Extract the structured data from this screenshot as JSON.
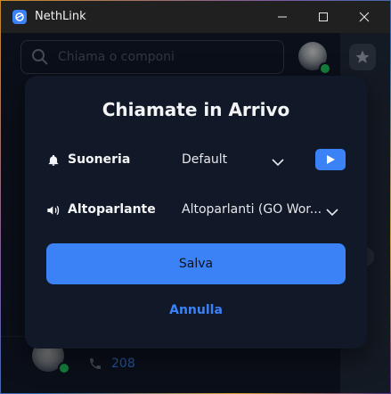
{
  "window": {
    "title": "NethLink"
  },
  "search": {
    "placeholder": "Chiama o componi"
  },
  "list": {
    "items": [
      {
        "extension": "208"
      }
    ]
  },
  "modal": {
    "title": "Chiamate in Arrivo",
    "ringtone": {
      "label": "Suoneria",
      "value": "Default"
    },
    "speaker": {
      "label": "Altoparlante",
      "value": "Altoparlanti (GO Wor..."
    },
    "save_label": "Salva",
    "cancel_label": "Annulla"
  },
  "colors": {
    "accent": "#3b82f6",
    "status_online": "#22c55e",
    "background": "#111827"
  },
  "icons": [
    "app-logo-icon",
    "minimize-icon",
    "maximize-icon",
    "close-icon",
    "search-icon",
    "star-icon",
    "bell-icon",
    "speaker-icon",
    "chevron-down-icon",
    "play-icon",
    "phone-icon"
  ]
}
